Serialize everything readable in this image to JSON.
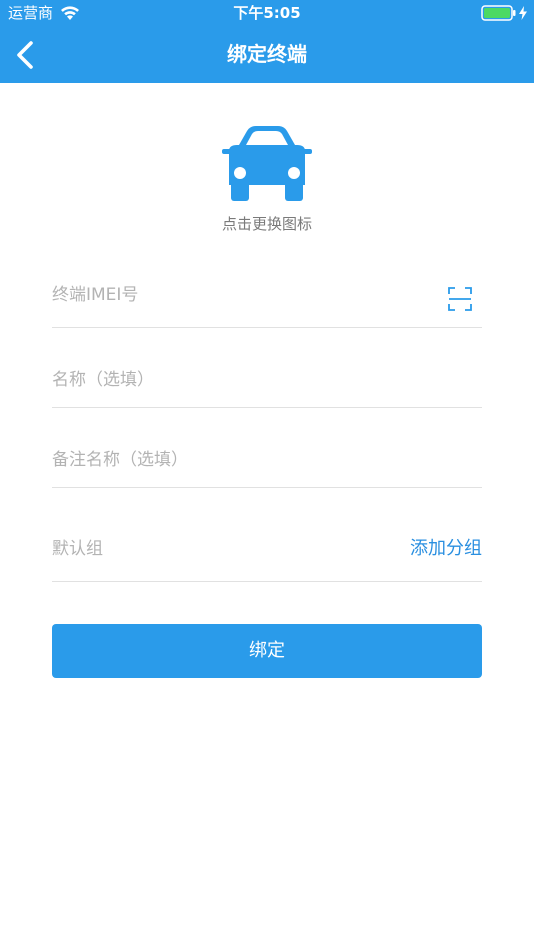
{
  "status_bar": {
    "carrier": "运营商",
    "time": "下午5:05",
    "icons": [
      "wifi-icon",
      "battery-icon",
      "charging-icon"
    ]
  },
  "nav": {
    "title": "绑定终端",
    "back_icon": "chevron-left-icon"
  },
  "icon_picker": {
    "icon": "car-icon",
    "caption": "点击更换图标"
  },
  "form": {
    "imei": {
      "placeholder": "终端IMEI号",
      "value": "",
      "scan_icon": "scan-icon"
    },
    "name": {
      "placeholder": "名称（选填）",
      "value": ""
    },
    "remark": {
      "placeholder": "备注名称（选填）",
      "value": ""
    },
    "group": {
      "label": "默认组",
      "add_link": "添加分组"
    }
  },
  "actions": {
    "bind_label": "绑定"
  },
  "colors": {
    "primary": "#2a9bea",
    "link": "#2a8fe0",
    "placeholder": "#b3b3b3",
    "divider": "#e1e1e1"
  }
}
